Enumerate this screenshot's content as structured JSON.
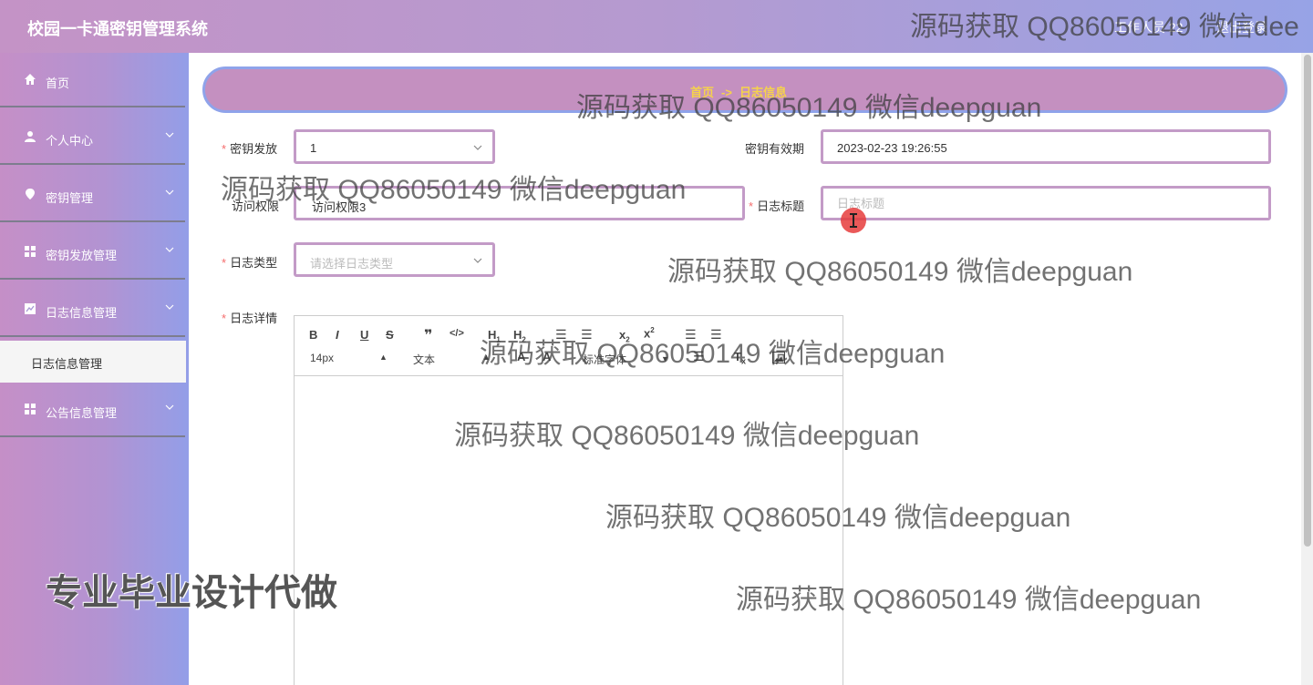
{
  "header": {
    "title": "校园一卡通密钥管理系统",
    "user": "工作人员 22",
    "logout": "退出登录"
  },
  "sidebar": {
    "items": [
      {
        "label": "首页",
        "icon": "home-icon"
      },
      {
        "label": "个人中心",
        "icon": "user-icon"
      },
      {
        "label": "密钥管理",
        "icon": "location-pin-icon"
      },
      {
        "label": "密钥发放管理",
        "icon": "grid-icon"
      },
      {
        "label": "日志信息管理",
        "icon": "chart-icon"
      },
      {
        "label": "公告信息管理",
        "icon": "grid-icon"
      }
    ],
    "active_sub": "日志信息管理"
  },
  "breadcrumb": {
    "home": "首页",
    "separator": "->",
    "current": "日志信息"
  },
  "form": {
    "key_issue": {
      "label": "密钥发放",
      "value": "1"
    },
    "key_validity": {
      "label": "密钥有效期",
      "value": "2023-02-23 19:26:55"
    },
    "access": {
      "label": "访问权限",
      "value": "访问权限3"
    },
    "log_title": {
      "label": "日志标题",
      "placeholder": "日志标题"
    },
    "log_type": {
      "label": "日志类型",
      "placeholder": "请选择日志类型"
    },
    "log_detail": {
      "label": "日志详情"
    }
  },
  "editor": {
    "font_size": "14px",
    "text_style": "文本",
    "font_family": "标准字体"
  },
  "watermarks": [
    "源码获取 QQ86050149 微信deepguan",
    "源码获取 QQ86050149 微信deepguan",
    "源码获取 QQ86050149 微信deepguan",
    "源码获取 QQ86050149 微信deepguan",
    "源码获取 QQ86050149 微信deepguan",
    "源码获取 QQ86050149 微信deepguan",
    "源码获取 QQ86050149 微信deepguan",
    "源码获取 QQ86050149 微信dee"
  ],
  "promo": "专业毕业设计代做",
  "colors": {
    "header_gradient_start": "#c493c6",
    "header_gradient_end": "#97a3e6",
    "field_border": "#c39bc7",
    "breadcrumb_bg": "#c490c0",
    "breadcrumb_text": "#f6d34a",
    "required": "#f56c6c"
  }
}
